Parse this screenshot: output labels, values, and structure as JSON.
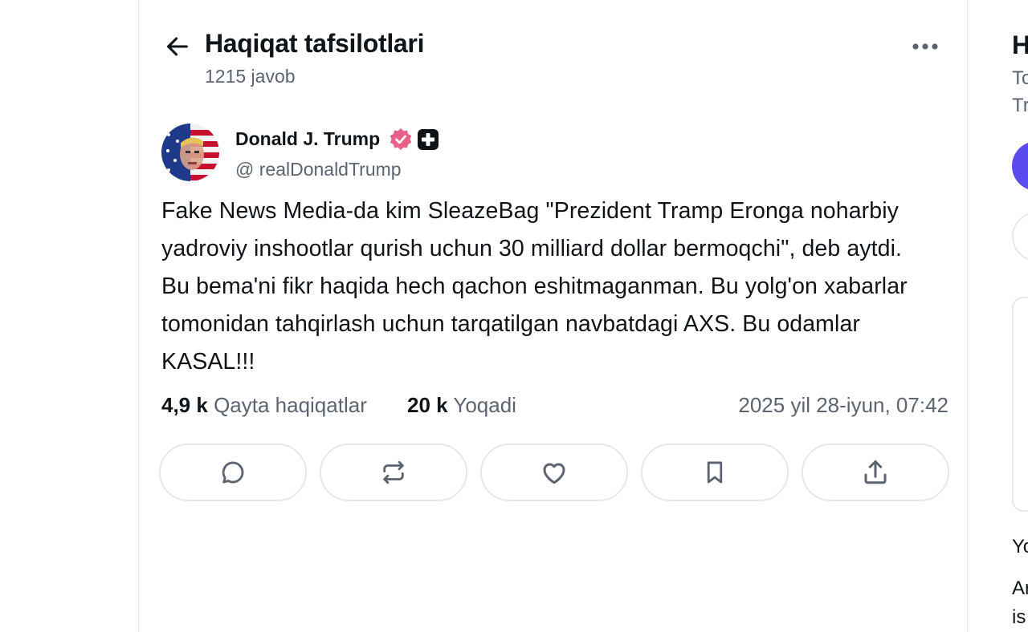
{
  "header": {
    "title": "Haqiqat tafsilotlari",
    "reply_count": "1215 javob"
  },
  "post": {
    "author_name": "Donald J. Trump",
    "handle": "@ realDonaldTrump",
    "text": "Fake News Media-da kim SleazeBag \"Prezident Tramp Eronga noharbiy yadroviy inshootlar qurish uchun 30 milliard dollar bermoqchi\", deb aytdi. Bu bema'ni fikr haqida hech qachon eshitmaganman. Bu yolg'on xabarlar tomonidan tahqirlash uchun tarqatilgan navbatdagi AXS. Bu odamlar KASAL!!!",
    "stats": {
      "retruths_count": "4,9 k",
      "retruths_label": "Qayta haqiqatlar",
      "likes_count": "20 k",
      "likes_label": "Yoqadi"
    },
    "timestamp": "2025 yil 28-iyun, 07:42"
  },
  "actions": [
    {
      "icon": "reply-icon"
    },
    {
      "icon": "retruth-icon"
    },
    {
      "icon": "heart-icon"
    },
    {
      "icon": "bookmark-icon"
    },
    {
      "icon": "share-icon"
    }
  ],
  "right_column": {
    "title": "H",
    "line1": "To",
    "line2": "Tr",
    "text1": "Yo",
    "text2": "Ar",
    "text3": "is"
  },
  "colors": {
    "accent": "#5b4cf0",
    "verified_badge": "#e8608a",
    "border": "#e6e8ec",
    "muted_text": "#5b6470"
  }
}
